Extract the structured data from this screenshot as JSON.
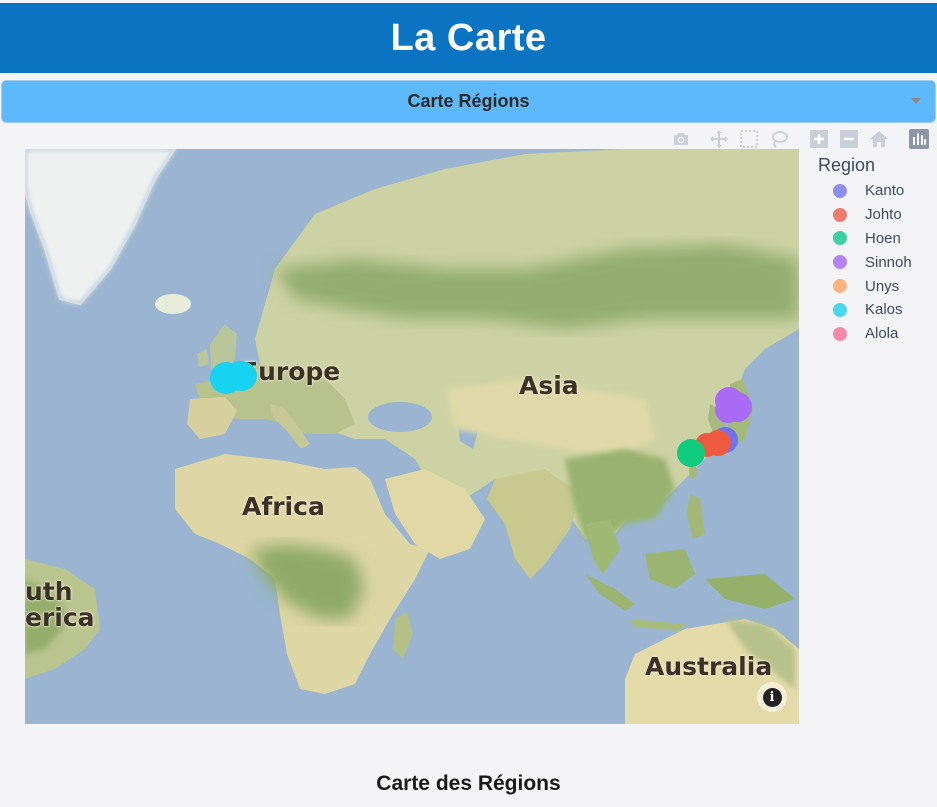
{
  "header": {
    "title": "La Carte"
  },
  "selector": {
    "value": "Carte Régions"
  },
  "modebar": {
    "icons": [
      "camera-icon",
      "pan-icon",
      "box-select-icon",
      "lasso-icon",
      "zoom-in-icon",
      "zoom-out-icon",
      "home-icon",
      "plotly-logo-icon"
    ]
  },
  "map": {
    "labels": {
      "europe": "Europe",
      "asia": "Asia",
      "africa": "Africa",
      "south_america_1": "uth",
      "south_america_2": "erica",
      "australia": "Australia"
    },
    "info_symbol": "i"
  },
  "legend": {
    "title": "Region",
    "items": [
      {
        "name": "Kanto",
        "color": "#8b8ff2"
      },
      {
        "name": "Johto",
        "color": "#ef7b6c"
      },
      {
        "name": "Hoen",
        "color": "#3dd1a1"
      },
      {
        "name": "Sinnoh",
        "color": "#b383f8"
      },
      {
        "name": "Unys",
        "color": "#ffb37f"
      },
      {
        "name": "Kalos",
        "color": "#47d8ef"
      },
      {
        "name": "Alola",
        "color": "#f88aa9"
      }
    ]
  },
  "footer": {
    "title": "Carte des Régions"
  }
}
